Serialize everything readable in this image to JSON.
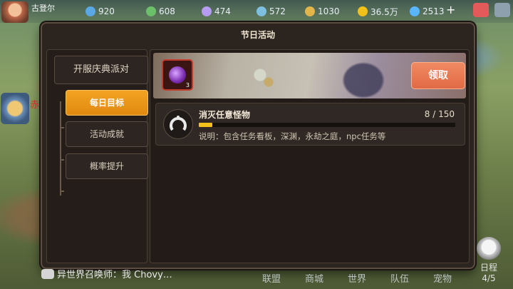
{
  "top_bar": {
    "player_name": "古登尔",
    "resources": [
      {
        "value": "920",
        "icon": "gem-icon",
        "color": "#5aa9e6"
      },
      {
        "value": "608",
        "icon": "clover-icon",
        "color": "#6cc06a"
      },
      {
        "value": "474",
        "icon": "ticket-icon",
        "color": "#b79df2"
      },
      {
        "value": "572",
        "icon": "crystal-icon",
        "color": "#7fbfe0"
      },
      {
        "value": "1030",
        "icon": "wheat-icon",
        "color": "#e2b64a"
      },
      {
        "value": "36.5万",
        "icon": "gold-coin-icon",
        "color": "#f2c21b"
      },
      {
        "value": "2513",
        "icon": "diamond-icon",
        "color": "#59b6ff"
      }
    ]
  },
  "dialog": {
    "title": "节日活动",
    "categories": {
      "main": "开服庆典派对",
      "subs": [
        {
          "label": "每日目标",
          "active": true
        },
        {
          "label": "活动成就",
          "active": false
        },
        {
          "label": "概率提升",
          "active": false
        }
      ]
    },
    "reward": {
      "count": "3",
      "claim_label": "领取"
    },
    "task": {
      "name": "消灭任意怪物",
      "progress_text": "8 / 150",
      "progress_fraction": 0.0533,
      "description": "说明：包含任务看板，深渊，永劫之庭，npc任务等"
    }
  },
  "left_badge_text": "赤",
  "chat": {
    "text": "异世界召唤师：我 Chovy…"
  },
  "bottom_nav": [
    "联盟",
    "商城",
    "世界",
    "队伍",
    "宠物"
  ],
  "schedule": {
    "label": "日程",
    "count": "4/5"
  }
}
